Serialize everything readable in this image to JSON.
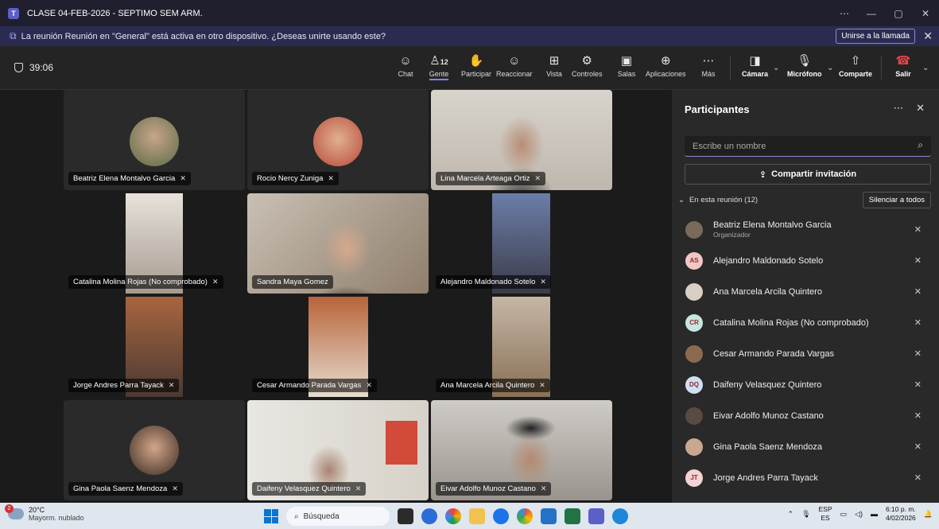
{
  "titlebar": {
    "title": "CLASE 04-FEB-2026 - SEPTIMO SEM ARM."
  },
  "notice": {
    "text": "La reunión Reunión en \"General\" está activa en otro dispositivo. ¿Deseas unirte usando este?",
    "join_label": "Unirse a la llamada"
  },
  "toolbar": {
    "timer": "39:06",
    "chat": "Chat",
    "people": "Gente",
    "people_count": "12",
    "participate": "Participar",
    "react": "Reaccionar",
    "view": "Vista",
    "controls": "Controles",
    "rooms": "Salas",
    "apps": "Aplicaciones",
    "more": "Más",
    "camera": "Cámara",
    "mic": "Micrófono",
    "share": "Comparte",
    "leave": "Salir"
  },
  "tiles": [
    {
      "name": "Beatriz Elena Montalvo Garcia"
    },
    {
      "name": "Rocio Nercy Zuniga"
    },
    {
      "name": "Lina Marcela Arteaga Ortiz"
    },
    {
      "name": "Catalina Molina Rojas (No comprobado)"
    },
    {
      "name": "Sandra Maya Gomez"
    },
    {
      "name": "Alejandro Maldonado Sotelo"
    },
    {
      "name": "Jorge Andres Parra Tayack"
    },
    {
      "name": "Cesar Armando Parada Vargas"
    },
    {
      "name": "Ana Marcela Arcila Quintero"
    },
    {
      "name": "Gina Paola Saenz Mendoza"
    },
    {
      "name": "Daifeny Velasquez Quintero"
    },
    {
      "name": "Eivar Adolfo Munoz Castano"
    }
  ],
  "panel": {
    "title": "Participantes",
    "search_placeholder": "Escribe un nombre",
    "share_invite": "Compartir invitación",
    "in_meeting": "En esta reunión (12)",
    "mute_all": "Silenciar a todos",
    "participants": [
      {
        "name": "Beatriz Elena Montalvo Garcia",
        "role": "Organizador",
        "initials": "",
        "color": "#7a6a5a"
      },
      {
        "name": "Alejandro Maldonado Sotelo",
        "role": "",
        "initials": "AS",
        "color": "#f3c6c6"
      },
      {
        "name": "Ana Marcela Arcila Quintero",
        "role": "",
        "initials": "",
        "color": "#d9cfc4"
      },
      {
        "name": "Catalina Molina Rojas (No comprobado)",
        "role": "",
        "initials": "CR",
        "color": "#c8e6df"
      },
      {
        "name": "Cesar Armando Parada Vargas",
        "role": "",
        "initials": "",
        "color": "#8a6b52"
      },
      {
        "name": "Daifeny Velasquez Quintero",
        "role": "",
        "initials": "DQ",
        "color": "#cfe0f5"
      },
      {
        "name": "Eivar Adolfo Munoz Castano",
        "role": "",
        "initials": "",
        "color": "#5a4a42"
      },
      {
        "name": "Gina Paola Saenz Mendoza",
        "role": "",
        "initials": "",
        "color": "#c9a791"
      },
      {
        "name": "Jorge Andres Parra Tayack",
        "role": "",
        "initials": "JT",
        "color": "#f5d3d3"
      }
    ]
  },
  "taskbar": {
    "temp": "20°C",
    "weather": "Mayorm. nublado",
    "weather_badge": "2",
    "search": "Búsqueda",
    "lang1": "ESP",
    "lang2": "ES",
    "time": "6:10 p. m.",
    "date": "4/02/2026"
  }
}
